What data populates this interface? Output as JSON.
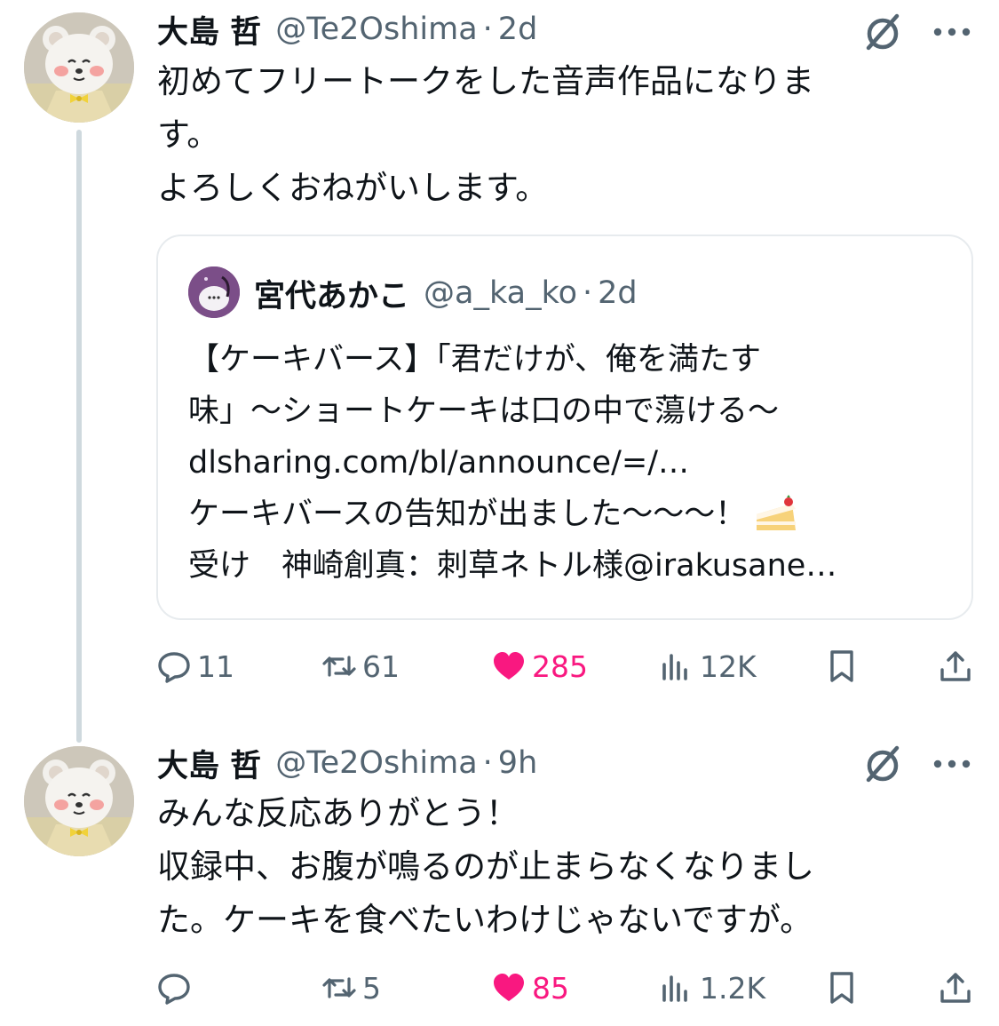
{
  "colors": {
    "text": "#0f1419",
    "secondary": "#536471",
    "like": "#f91880",
    "border": "#e7ebee",
    "thread_line": "#cfd9de"
  },
  "icons": [
    "grok-icon",
    "more-icon",
    "reply-icon",
    "retweet-icon",
    "heart-icon",
    "views-icon",
    "bookmark-icon",
    "share-icon"
  ],
  "tweets": [
    {
      "name": "大島 哲",
      "handle": "@Te2Oshima",
      "separator": "·",
      "time": "2d",
      "body_lines": [
        "初めてフリートークをした音声作品になりま",
        "す。",
        "よろしくおねがいします。"
      ],
      "quote": {
        "name": "宮代あかこ",
        "handle": "@a_ka_ko",
        "separator": "·",
        "time": "2d",
        "lines": [
          "【ケーキバース】「君だけが、俺を満たす",
          "味」～ショートケーキは口の中で蕩ける～",
          "dlsharing.com/bl/announce/=/…",
          "ケーキバースの告知が出ました～～～！",
          "受け　神崎創真：刺草ネトル様@irakusane…"
        ]
      },
      "actions": {
        "replies": "11",
        "retweets": "61",
        "likes": "285",
        "views": "12K"
      }
    },
    {
      "name": "大島 哲",
      "handle": "@Te2Oshima",
      "separator": "·",
      "time": "9h",
      "body_lines": [
        "みんな反応ありがとう！",
        "収録中、お腹が鳴るのが止まらなくなりまし",
        "た。ケーキを食べたいわけじゃないですが。"
      ],
      "actions": {
        "replies": "",
        "retweets": "5",
        "likes": "85",
        "views": "1.2K"
      }
    }
  ]
}
